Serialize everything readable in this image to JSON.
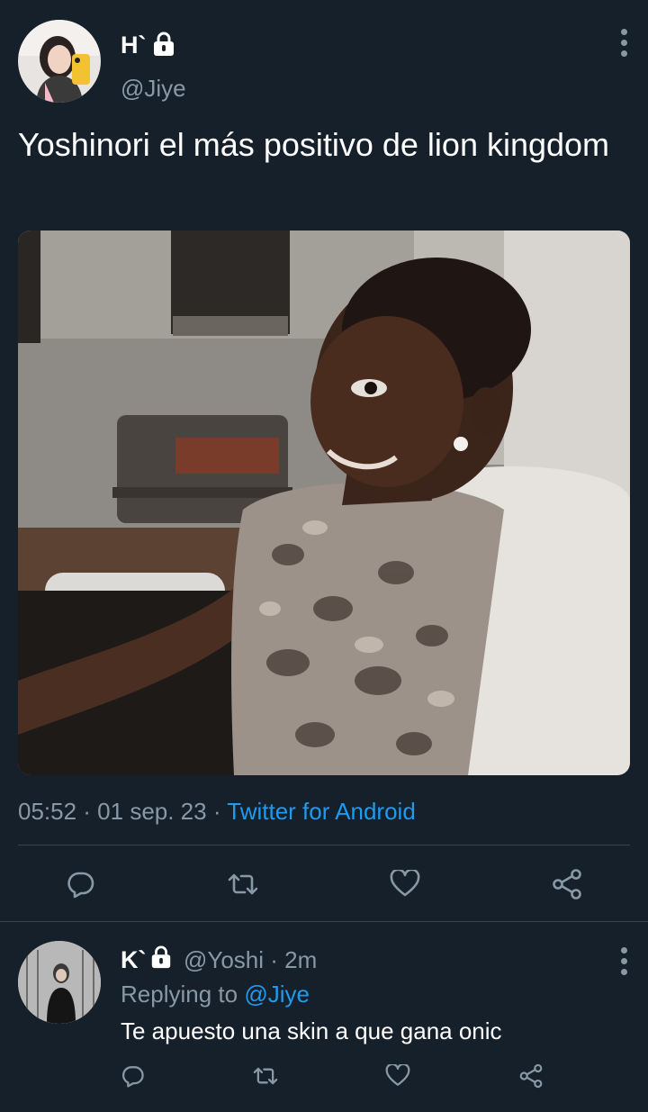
{
  "main_tweet": {
    "display_name": "H`",
    "handle": "@Jiye",
    "text": "Yoshinori el más positivo de lion kingdom",
    "timestamp": "05:52 · 01 sep. 23 · ",
    "source": "Twitter for Android",
    "icons": {
      "lock": "lock-icon",
      "more": "more-vertical-icon",
      "reply": "reply-icon",
      "retweet": "retweet-icon",
      "like": "heart-icon",
      "share": "share-icon"
    }
  },
  "reply_tweet": {
    "display_name": "K`",
    "handle_time": "@Yoshi · 2m",
    "replying_prefix": "Replying to ",
    "replying_mention": "@Jiye",
    "text": "Te apuesto una skin a que gana onic"
  },
  "colors": {
    "background": "#15202b",
    "secondary_text": "#8899a6",
    "accent": "#1d9bf0",
    "divider": "#38444d"
  }
}
